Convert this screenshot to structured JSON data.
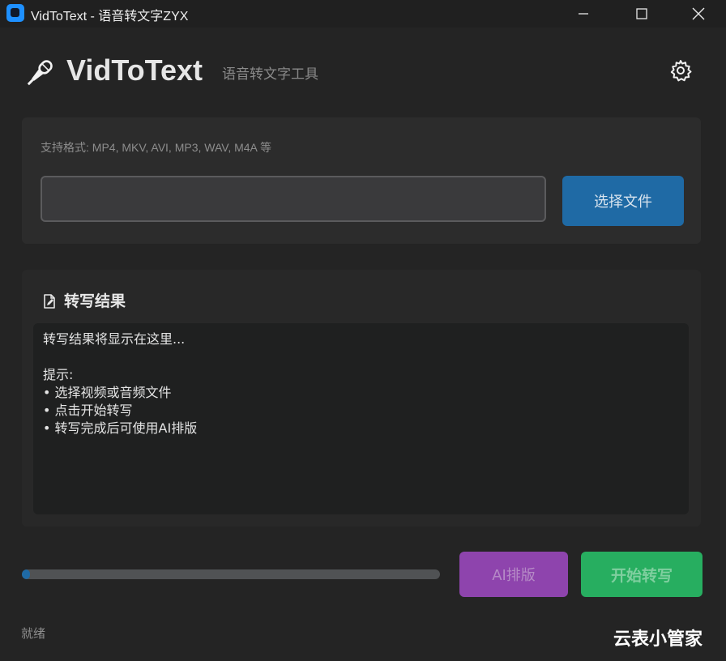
{
  "titlebar": {
    "title": "VidToText - 语音转文字ZYX",
    "minimize_icon": "minimize-icon",
    "maximize_icon": "maximize-icon",
    "close_icon": "close-icon"
  },
  "header": {
    "logo_icon": "microphone-icon",
    "brand": "VidToText",
    "subtitle": "语音转文字工具",
    "settings_icon": "gear-icon"
  },
  "file_panel": {
    "formats": "支持格式: MP4, MKV, AVI, MP3, WAV, M4A 等",
    "path_value": "",
    "select_button": "选择文件"
  },
  "result": {
    "icon": "edit-document-icon",
    "title": "转写结果",
    "text": "转写结果将显示在这里...\n\n提示:\n• 选择视频或音频文件\n• 点击开始转写\n• 转写完成后可使用AI排版"
  },
  "controls": {
    "progress": 0.02,
    "ai_button": "AI排版",
    "start_button": "开始转写"
  },
  "status": "就绪",
  "watermark": "云表小管家",
  "colors": {
    "accent_blue": "#1f6aa5",
    "ai_purple": "#8e44ad",
    "start_green": "#27ae60"
  }
}
